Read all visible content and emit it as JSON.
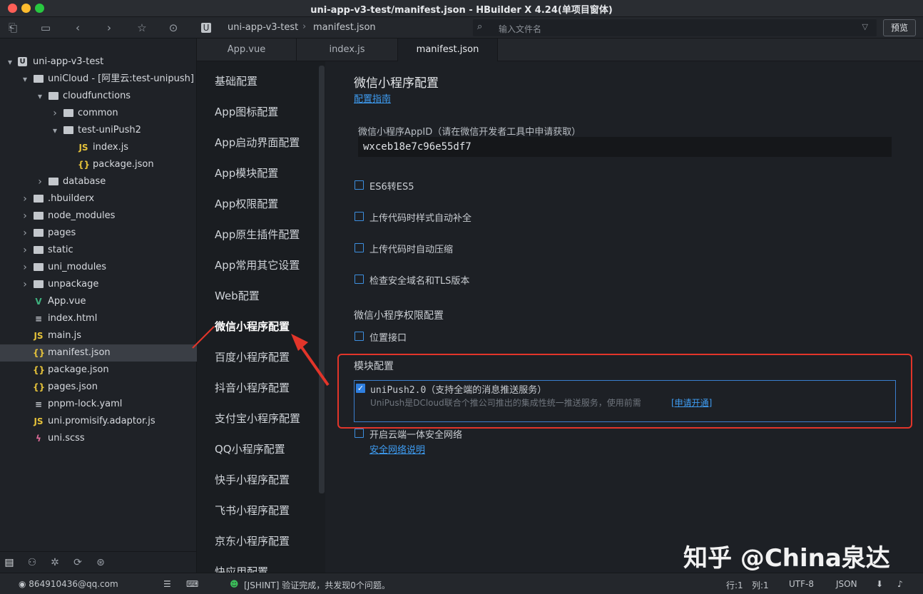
{
  "window": {
    "title": "uni-app-v3-test/manifest.json - HBuilder X 4.24(单项目窗体)"
  },
  "toolbar": {
    "breadcrumb": [
      "uni-app-v3-test",
      "manifest.json"
    ],
    "search_placeholder": "输入文件名",
    "preview_label": "预览"
  },
  "tree": [
    {
      "label": "uni-app-v3-test",
      "depth": 0,
      "icon": "project-icon",
      "caret": "open"
    },
    {
      "label": "uniCloud - [阿里云:test-unipush]",
      "depth": 1,
      "icon": "folder-icon",
      "caret": "open"
    },
    {
      "label": "cloudfunctions",
      "depth": 2,
      "icon": "folder-icon",
      "caret": "open"
    },
    {
      "label": "common",
      "depth": 3,
      "icon": "folder-icon",
      "caret": "closed"
    },
    {
      "label": "test-uniPush2",
      "depth": 3,
      "icon": "folder-icon",
      "caret": "open"
    },
    {
      "label": "index.js",
      "depth": 4,
      "icon": "js-file-icon",
      "caret": ""
    },
    {
      "label": "package.json",
      "depth": 4,
      "icon": "json-file-icon",
      "caret": ""
    },
    {
      "label": "database",
      "depth": 2,
      "icon": "folder-icon",
      "caret": "closed"
    },
    {
      "label": ".hbuilderx",
      "depth": 1,
      "icon": "folder-icon",
      "caret": "closed"
    },
    {
      "label": "node_modules",
      "depth": 1,
      "icon": "folder-icon",
      "caret": "closed"
    },
    {
      "label": "pages",
      "depth": 1,
      "icon": "folder-icon",
      "caret": "closed"
    },
    {
      "label": "static",
      "depth": 1,
      "icon": "folder-icon",
      "caret": "closed"
    },
    {
      "label": "uni_modules",
      "depth": 1,
      "icon": "folder-icon",
      "caret": "closed"
    },
    {
      "label": "unpackage",
      "depth": 1,
      "icon": "folder-icon",
      "caret": "closed"
    },
    {
      "label": "App.vue",
      "depth": 1,
      "icon": "vue-file-icon",
      "caret": ""
    },
    {
      "label": "index.html",
      "depth": 1,
      "icon": "html-file-icon",
      "caret": ""
    },
    {
      "label": "main.js",
      "depth": 1,
      "icon": "js-file-icon",
      "caret": ""
    },
    {
      "label": "manifest.json",
      "depth": 1,
      "icon": "json-file-icon",
      "caret": "",
      "selected": true
    },
    {
      "label": "package.json",
      "depth": 1,
      "icon": "json-file-icon",
      "caret": ""
    },
    {
      "label": "pages.json",
      "depth": 1,
      "icon": "json-file-icon",
      "caret": ""
    },
    {
      "label": "pnpm-lock.yaml",
      "depth": 1,
      "icon": "yaml-file-icon",
      "caret": ""
    },
    {
      "label": "uni.promisify.adaptor.js",
      "depth": 1,
      "icon": "js-file-icon",
      "caret": ""
    },
    {
      "label": "uni.scss",
      "depth": 1,
      "icon": "scss-file-icon",
      "caret": ""
    }
  ],
  "tabs": [
    "App.vue",
    "index.js",
    "manifest.json"
  ],
  "nav": [
    "基础配置",
    "App图标配置",
    "App启动界面配置",
    "App模块配置",
    "App权限配置",
    "App原生插件配置",
    "App常用其它设置",
    "Web配置",
    "微信小程序配置",
    "百度小程序配置",
    "抖音小程序配置",
    "支付宝小程序配置",
    "QQ小程序配置",
    "快手小程序配置",
    "飞书小程序配置",
    "京东小程序配置",
    "快应用配置"
  ],
  "nav_active_index": 8,
  "main": {
    "title": "微信小程序配置",
    "guide_link": "配置指南",
    "appid_label": "微信小程序AppID（请在微信开发者工具中申请获取）",
    "appid_value": "wxceb18e7c96e55df7",
    "options": [
      "ES6转ES5",
      "上传代码时样式自动补全",
      "上传代码时自动压缩",
      "检查安全域名和TLS版本"
    ],
    "permission_header": "微信小程序权限配置",
    "location_label": "位置接口",
    "module_header": "模块配置",
    "unipush_title": "uniPush2.0（支持全端的消息推送服务）",
    "unipush_desc": "UniPush是DCloud联合个推公司推出的集成性统一推送服务，使用前需",
    "unipush_link": "[申请开通]",
    "secure_net_label": "开启云端一体安全网络",
    "secure_net_link": "安全网络说明"
  },
  "status": {
    "user": "864910436@qq.com",
    "lint": "[JSHINT] 验证完成，共发现0个问题。",
    "line": "行:1",
    "col": "列:1",
    "encoding": "UTF-8",
    "language": "JSON"
  },
  "watermark": "知乎 @China泉达",
  "colors": {
    "accent": "#3e9cf2",
    "highlight_red": "#e2352a",
    "checkbox": "#2f7fe0"
  }
}
